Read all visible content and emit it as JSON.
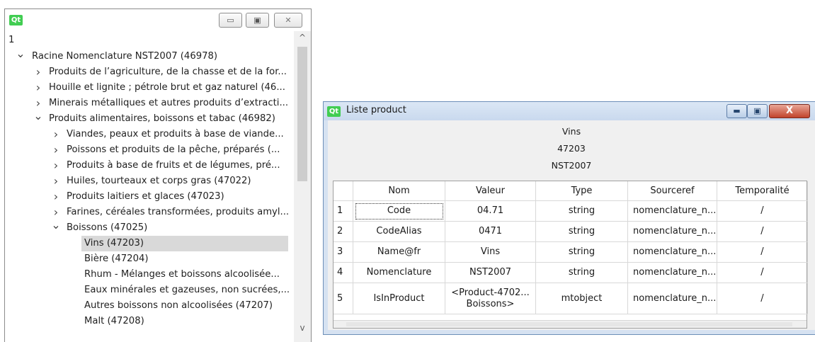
{
  "tree_window": {
    "logo": "Qt",
    "buttons": {
      "minimize": "▭",
      "maximize": "▣",
      "close": "✕"
    },
    "top_value": "1",
    "items": [
      {
        "label": "Racine Nomenclature NST2007 (46978)",
        "level": 0,
        "expander": "expanded"
      },
      {
        "label": "Produits de l’agriculture, de la chasse et de la for...",
        "level": 1,
        "expander": "collapsed"
      },
      {
        "label": "Houille et lignite ; pétrole brut et gaz naturel (46...",
        "level": 1,
        "expander": "collapsed"
      },
      {
        "label": "Minerais métalliques et autres produits d’extracti...",
        "level": 1,
        "expander": "collapsed"
      },
      {
        "label": "Produits alimentaires, boissons et tabac (46982)",
        "level": 1,
        "expander": "expanded"
      },
      {
        "label": "Viandes, peaux et produits à base de viande...",
        "level": 2,
        "expander": "collapsed"
      },
      {
        "label": "Poissons et produits de la pêche, préparés (...",
        "level": 2,
        "expander": "collapsed"
      },
      {
        "label": "Produits à base de fruits et de légumes, pré...",
        "level": 2,
        "expander": "collapsed"
      },
      {
        "label": "Huiles, tourteaux et corps gras (47022)",
        "level": 2,
        "expander": "collapsed"
      },
      {
        "label": "Produits laitiers et glaces (47023)",
        "level": 2,
        "expander": "collapsed"
      },
      {
        "label": "Farines, céréales transformées, produits amyl...",
        "level": 2,
        "expander": "collapsed"
      },
      {
        "label": "Boissons (47025)",
        "level": 2,
        "expander": "expanded"
      },
      {
        "label": "Vins (47203)",
        "level": 3,
        "expander": "none",
        "selected": true
      },
      {
        "label": "Bière (47204)",
        "level": 3,
        "expander": "none"
      },
      {
        "label": "Rhum - Mélanges et boissons alcoolisée...",
        "level": 3,
        "expander": "none"
      },
      {
        "label": "Eaux minérales et gazeuses, non sucrées,...",
        "level": 3,
        "expander": "none"
      },
      {
        "label": "Autres boissons non alcoolisées (47207)",
        "level": 3,
        "expander": "none"
      },
      {
        "label": "Malt (47208)",
        "level": 3,
        "expander": "none"
      }
    ],
    "scroll": {
      "up": "^",
      "down": "v"
    }
  },
  "product_window": {
    "logo": "Qt",
    "title": "Liste product",
    "buttons": {
      "minimize": "▬",
      "maximize": "▣",
      "close": "X"
    },
    "header_lines": [
      "Vins",
      "47203",
      "NST2007"
    ],
    "columns": [
      "Nom",
      "Valeur",
      "Type",
      "Sourceref",
      "Temporalité"
    ],
    "rows": [
      {
        "num": "1",
        "nom": "Code",
        "valeur": "04.71",
        "type": "string",
        "sourceref": "nomenclature_n...",
        "temporalite": "/"
      },
      {
        "num": "2",
        "nom": "CodeAlias",
        "valeur": "0471",
        "type": "string",
        "sourceref": "nomenclature_n...",
        "temporalite": "/"
      },
      {
        "num": "3",
        "nom": "Name@fr",
        "valeur": "Vins",
        "type": "string",
        "sourceref": "nomenclature_n...",
        "temporalite": "/"
      },
      {
        "num": "4",
        "nom": "Nomenclature",
        "valeur": "NST2007",
        "type": "string",
        "sourceref": "nomenclature_n...",
        "temporalite": "/"
      },
      {
        "num": "5",
        "nom": "IsInProduct",
        "valeur": "<Product-4702... Boissons>",
        "type": "mtobject",
        "sourceref": "nomenclature_n...",
        "temporalite": "/"
      }
    ]
  }
}
